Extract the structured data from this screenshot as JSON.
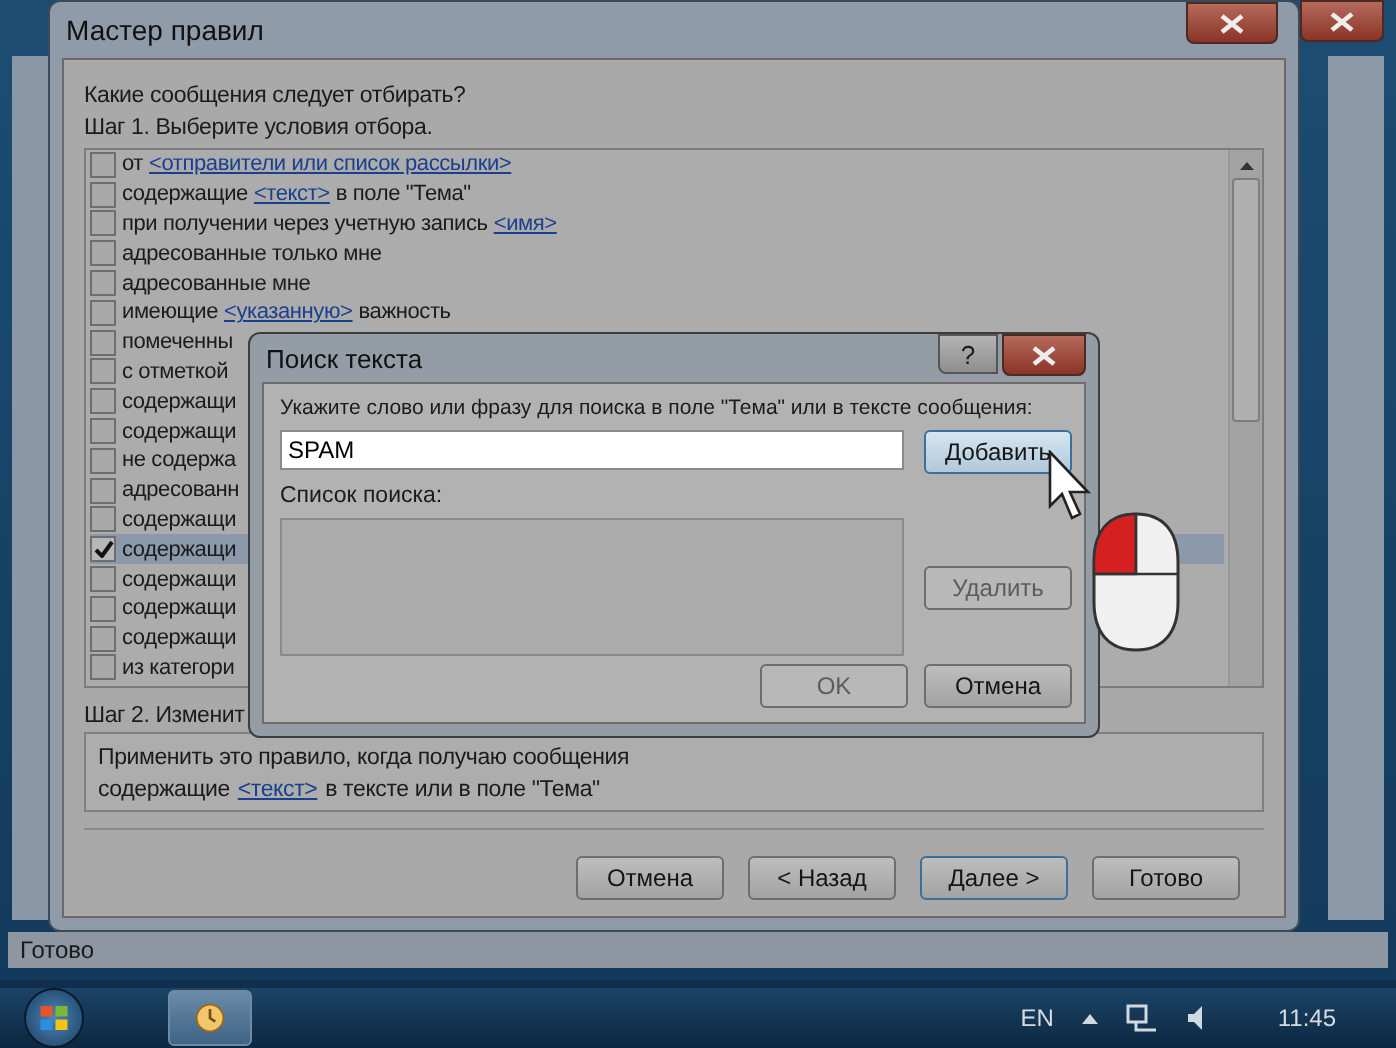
{
  "wizard": {
    "title": "Мастер правил",
    "question": "Какие сообщения следует отбирать?",
    "step1": "Шаг 1. Выберите условия отбора.",
    "conditions": [
      {
        "checked": false,
        "selected": false,
        "parts": [
          {
            "kind": "text",
            "text": "от"
          },
          {
            "kind": "link",
            "text": "<отправители или список рассылки>"
          }
        ]
      },
      {
        "checked": false,
        "selected": false,
        "parts": [
          {
            "kind": "text",
            "text": "содержащие"
          },
          {
            "kind": "link",
            "text": "<текст>"
          },
          {
            "kind": "text",
            "text": "в поле \"Тема\""
          }
        ]
      },
      {
        "checked": false,
        "selected": false,
        "parts": [
          {
            "kind": "text",
            "text": "при получении через учетную запись"
          },
          {
            "kind": "link",
            "text": "<имя>"
          }
        ]
      },
      {
        "checked": false,
        "selected": false,
        "parts": [
          {
            "kind": "text",
            "text": "адресованные только мне"
          }
        ]
      },
      {
        "checked": false,
        "selected": false,
        "parts": [
          {
            "kind": "text",
            "text": "адресованные мне"
          }
        ]
      },
      {
        "checked": false,
        "selected": false,
        "parts": [
          {
            "kind": "text",
            "text": "имеющие"
          },
          {
            "kind": "link",
            "text": "<указанную>"
          },
          {
            "kind": "text",
            "text": "важность"
          }
        ]
      },
      {
        "checked": false,
        "selected": false,
        "parts": [
          {
            "kind": "text",
            "text": "помеченны"
          }
        ]
      },
      {
        "checked": false,
        "selected": false,
        "parts": [
          {
            "kind": "text",
            "text": "с отметкой"
          }
        ]
      },
      {
        "checked": false,
        "selected": false,
        "parts": [
          {
            "kind": "text",
            "text": "содержащи"
          }
        ]
      },
      {
        "checked": false,
        "selected": false,
        "parts": [
          {
            "kind": "text",
            "text": "содержащи"
          }
        ]
      },
      {
        "checked": false,
        "selected": false,
        "parts": [
          {
            "kind": "text",
            "text": "не содержа"
          }
        ]
      },
      {
        "checked": false,
        "selected": false,
        "parts": [
          {
            "kind": "text",
            "text": "адресованн"
          }
        ]
      },
      {
        "checked": false,
        "selected": false,
        "parts": [
          {
            "kind": "text",
            "text": "содержащи"
          }
        ]
      },
      {
        "checked": true,
        "selected": true,
        "parts": [
          {
            "kind": "text",
            "text": "содержащи"
          }
        ]
      },
      {
        "checked": false,
        "selected": false,
        "parts": [
          {
            "kind": "text",
            "text": "содержащи"
          }
        ]
      },
      {
        "checked": false,
        "selected": false,
        "parts": [
          {
            "kind": "text",
            "text": "содержащи"
          }
        ]
      },
      {
        "checked": false,
        "selected": false,
        "parts": [
          {
            "kind": "text",
            "text": "содержащи"
          }
        ]
      },
      {
        "checked": false,
        "selected": false,
        "parts": [
          {
            "kind": "text",
            "text": "из категори"
          }
        ]
      }
    ],
    "step2": "Шаг 2. Изменит",
    "description": [
      [
        {
          "kind": "text",
          "text": "Применить это правило, когда получаю сообщения"
        }
      ],
      [
        {
          "kind": "text",
          "text": "содержащие"
        },
        {
          "kind": "link",
          "text": "<текст>"
        },
        {
          "kind": "text",
          "text": "в тексте или в поле \"Тема\""
        }
      ]
    ],
    "buttons": [
      {
        "label": "Отмена",
        "default": false
      },
      {
        "label": "< Назад",
        "default": false
      },
      {
        "label": "Далее >",
        "default": true
      },
      {
        "label": "Готово",
        "default": false
      }
    ]
  },
  "dialog": {
    "title": "Поиск текста",
    "help": "?",
    "prompt": "Укажите слово или фразу для поиска в поле \"Тема\" или в тексте сообщения:",
    "input": {
      "value": "SPAM"
    },
    "add_button": {
      "label": "Добавить",
      "hovered": true
    },
    "list_label": "Список поиска:",
    "remove_button": {
      "label": "Удалить",
      "disabled": true
    },
    "ok_button": {
      "label": "OK",
      "disabled": true
    },
    "cancel_button": {
      "label": "Отмена",
      "disabled": false
    }
  },
  "status_bar": {
    "text": "Готово"
  },
  "taskbar": {
    "language": "EN",
    "time": "11:45"
  }
}
